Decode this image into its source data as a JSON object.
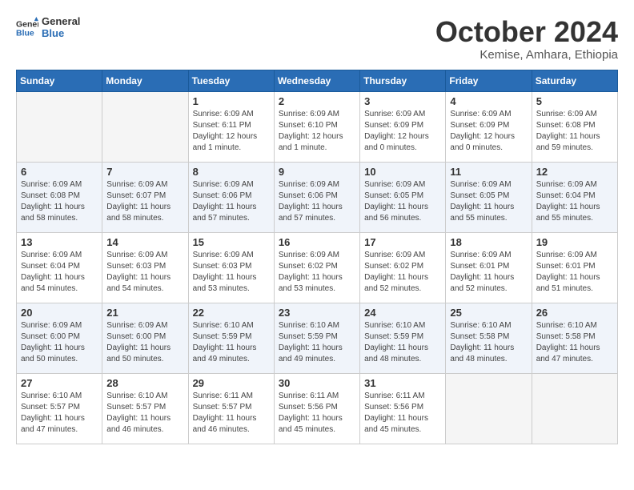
{
  "header": {
    "logo_general": "General",
    "logo_blue": "Blue",
    "month_title": "October 2024",
    "subtitle": "Kemise, Amhara, Ethiopia"
  },
  "weekdays": [
    "Sunday",
    "Monday",
    "Tuesday",
    "Wednesday",
    "Thursday",
    "Friday",
    "Saturday"
  ],
  "weeks": [
    [
      {
        "day": "",
        "info": ""
      },
      {
        "day": "",
        "info": ""
      },
      {
        "day": "1",
        "info": "Sunrise: 6:09 AM\nSunset: 6:11 PM\nDaylight: 12 hours\nand 1 minute."
      },
      {
        "day": "2",
        "info": "Sunrise: 6:09 AM\nSunset: 6:10 PM\nDaylight: 12 hours\nand 1 minute."
      },
      {
        "day": "3",
        "info": "Sunrise: 6:09 AM\nSunset: 6:09 PM\nDaylight: 12 hours\nand 0 minutes."
      },
      {
        "day": "4",
        "info": "Sunrise: 6:09 AM\nSunset: 6:09 PM\nDaylight: 12 hours\nand 0 minutes."
      },
      {
        "day": "5",
        "info": "Sunrise: 6:09 AM\nSunset: 6:08 PM\nDaylight: 11 hours\nand 59 minutes."
      }
    ],
    [
      {
        "day": "6",
        "info": "Sunrise: 6:09 AM\nSunset: 6:08 PM\nDaylight: 11 hours\nand 58 minutes."
      },
      {
        "day": "7",
        "info": "Sunrise: 6:09 AM\nSunset: 6:07 PM\nDaylight: 11 hours\nand 58 minutes."
      },
      {
        "day": "8",
        "info": "Sunrise: 6:09 AM\nSunset: 6:06 PM\nDaylight: 11 hours\nand 57 minutes."
      },
      {
        "day": "9",
        "info": "Sunrise: 6:09 AM\nSunset: 6:06 PM\nDaylight: 11 hours\nand 57 minutes."
      },
      {
        "day": "10",
        "info": "Sunrise: 6:09 AM\nSunset: 6:05 PM\nDaylight: 11 hours\nand 56 minutes."
      },
      {
        "day": "11",
        "info": "Sunrise: 6:09 AM\nSunset: 6:05 PM\nDaylight: 11 hours\nand 55 minutes."
      },
      {
        "day": "12",
        "info": "Sunrise: 6:09 AM\nSunset: 6:04 PM\nDaylight: 11 hours\nand 55 minutes."
      }
    ],
    [
      {
        "day": "13",
        "info": "Sunrise: 6:09 AM\nSunset: 6:04 PM\nDaylight: 11 hours\nand 54 minutes."
      },
      {
        "day": "14",
        "info": "Sunrise: 6:09 AM\nSunset: 6:03 PM\nDaylight: 11 hours\nand 54 minutes."
      },
      {
        "day": "15",
        "info": "Sunrise: 6:09 AM\nSunset: 6:03 PM\nDaylight: 11 hours\nand 53 minutes."
      },
      {
        "day": "16",
        "info": "Sunrise: 6:09 AM\nSunset: 6:02 PM\nDaylight: 11 hours\nand 53 minutes."
      },
      {
        "day": "17",
        "info": "Sunrise: 6:09 AM\nSunset: 6:02 PM\nDaylight: 11 hours\nand 52 minutes."
      },
      {
        "day": "18",
        "info": "Sunrise: 6:09 AM\nSunset: 6:01 PM\nDaylight: 11 hours\nand 52 minutes."
      },
      {
        "day": "19",
        "info": "Sunrise: 6:09 AM\nSunset: 6:01 PM\nDaylight: 11 hours\nand 51 minutes."
      }
    ],
    [
      {
        "day": "20",
        "info": "Sunrise: 6:09 AM\nSunset: 6:00 PM\nDaylight: 11 hours\nand 50 minutes."
      },
      {
        "day": "21",
        "info": "Sunrise: 6:09 AM\nSunset: 6:00 PM\nDaylight: 11 hours\nand 50 minutes."
      },
      {
        "day": "22",
        "info": "Sunrise: 6:10 AM\nSunset: 5:59 PM\nDaylight: 11 hours\nand 49 minutes."
      },
      {
        "day": "23",
        "info": "Sunrise: 6:10 AM\nSunset: 5:59 PM\nDaylight: 11 hours\nand 49 minutes."
      },
      {
        "day": "24",
        "info": "Sunrise: 6:10 AM\nSunset: 5:59 PM\nDaylight: 11 hours\nand 48 minutes."
      },
      {
        "day": "25",
        "info": "Sunrise: 6:10 AM\nSunset: 5:58 PM\nDaylight: 11 hours\nand 48 minutes."
      },
      {
        "day": "26",
        "info": "Sunrise: 6:10 AM\nSunset: 5:58 PM\nDaylight: 11 hours\nand 47 minutes."
      }
    ],
    [
      {
        "day": "27",
        "info": "Sunrise: 6:10 AM\nSunset: 5:57 PM\nDaylight: 11 hours\nand 47 minutes."
      },
      {
        "day": "28",
        "info": "Sunrise: 6:10 AM\nSunset: 5:57 PM\nDaylight: 11 hours\nand 46 minutes."
      },
      {
        "day": "29",
        "info": "Sunrise: 6:11 AM\nSunset: 5:57 PM\nDaylight: 11 hours\nand 46 minutes."
      },
      {
        "day": "30",
        "info": "Sunrise: 6:11 AM\nSunset: 5:56 PM\nDaylight: 11 hours\nand 45 minutes."
      },
      {
        "day": "31",
        "info": "Sunrise: 6:11 AM\nSunset: 5:56 PM\nDaylight: 11 hours\nand 45 minutes."
      },
      {
        "day": "",
        "info": ""
      },
      {
        "day": "",
        "info": ""
      }
    ]
  ]
}
